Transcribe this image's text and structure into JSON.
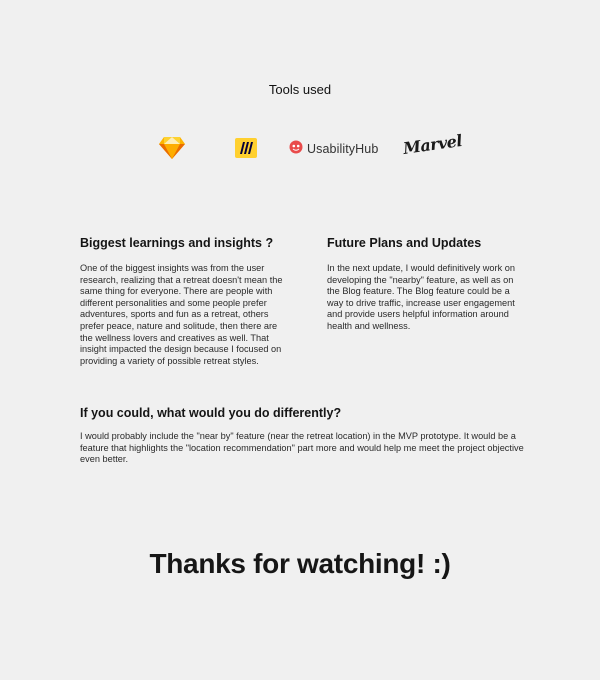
{
  "tools": {
    "title": "Tools used",
    "logos": [
      {
        "icon": "sketch-icon"
      },
      {
        "icon": "miro-icon"
      },
      {
        "icon": "usabilityhub-icon",
        "label": "UsabilityHub"
      },
      {
        "icon": "marvel-logo",
        "label": "Marvel"
      }
    ]
  },
  "learnings": {
    "heading": "Biggest learnings and insights ?",
    "body": "One of the biggest insights was from the user research, realizing that a retreat doesn't mean the same thing for everyone. There are people with different personalities and some people prefer adventures, sports and fun as a retreat, others prefer peace, nature and solitude, then there are the wellness lovers and creatives as well. That insight impacted the design because I focused on providing a variety of possible retreat styles."
  },
  "future": {
    "heading": "Future Plans and Updates",
    "body": "In the next update, I would definitively work on developing the \"nearby\" feature, as well as on the Blog feature. The Blog feature could be a way to drive traffic, increase user engagement and  provide users  helpful information around health and wellness."
  },
  "differently": {
    "heading": "If you could, what would you do differently?",
    "body": "I would probably include the  \"near by\" feature (near the retreat location) in the MVP prototype. It would be a feature that highlights the \"location recommendation\" part more and would help me meet the project objective even better."
  },
  "closing": "Thanks for watching! :)"
}
